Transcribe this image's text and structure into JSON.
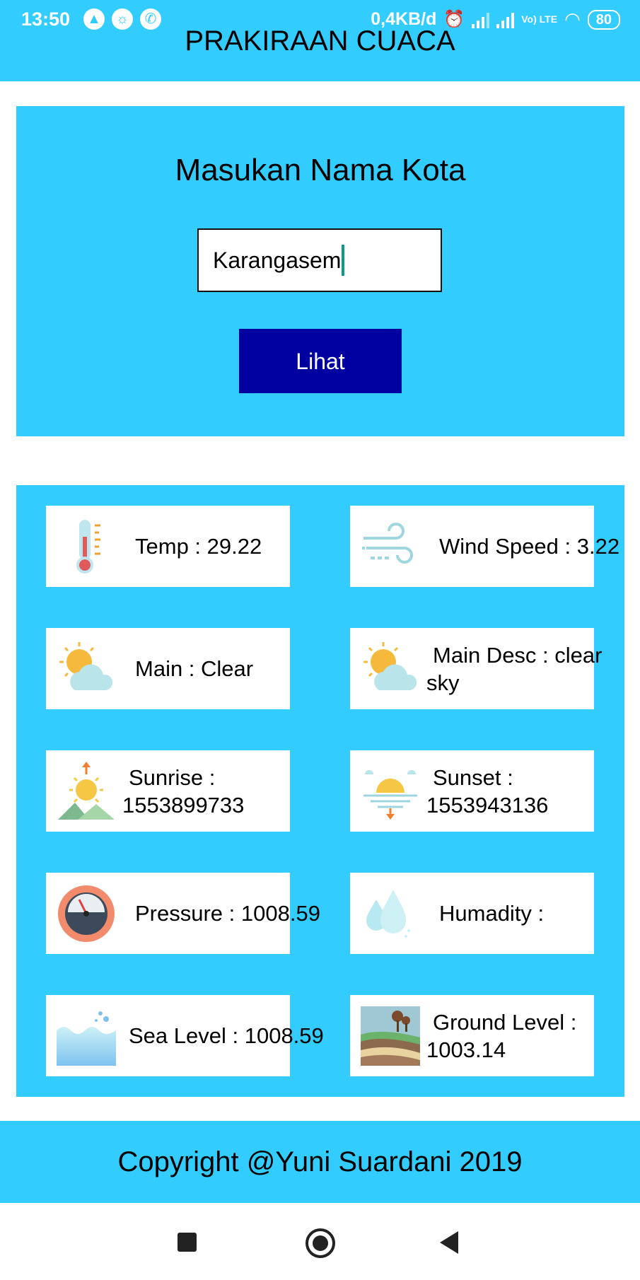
{
  "status_bar": {
    "time": "13:50",
    "speed": "0,4KB/d",
    "lte": "Vo) LTE",
    "battery": "80"
  },
  "header": {
    "title": "PRAKIRAAN CUACA"
  },
  "search": {
    "heading": "Masukan Nama Kota",
    "city_value": "Karangasem",
    "button_label": "Lihat"
  },
  "weather": {
    "temp": "Temp : 29.22",
    "wind_speed": "Wind Speed : 3.22",
    "main": "Main : Clear",
    "main_desc": "Main Desc : clear sky",
    "sunrise": "Sunrise : 1553899733",
    "sunset": "Sunset : 1553943136",
    "pressure": "Pressure : 1008.59",
    "humidity": "Humadity :",
    "sea_level": "Sea Level : 1008.59",
    "ground_level": "Ground Level : 1003.14"
  },
  "footer": {
    "text": "Copyright @Yuni Suardani 2019"
  },
  "colors": {
    "accent": "#33ccff",
    "button": "#0000a0"
  }
}
